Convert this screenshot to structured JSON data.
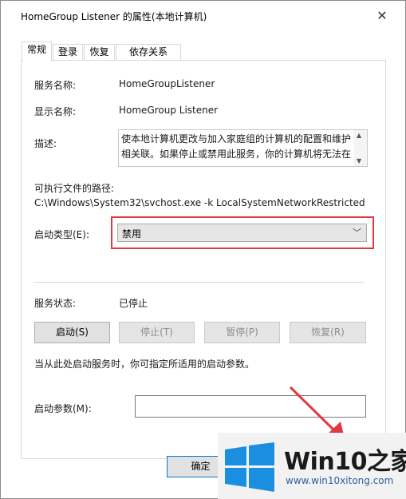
{
  "window": {
    "title": "HomeGroup Listener 的属性(本地计算机)",
    "close_glyph": "✕"
  },
  "tabs": [
    {
      "label": "常规",
      "active": true
    },
    {
      "label": "登录",
      "active": false
    },
    {
      "label": "恢复",
      "active": false
    },
    {
      "label": "依存关系",
      "active": false
    }
  ],
  "general": {
    "service_name_label": "服务名称:",
    "service_name": "HomeGroupListener",
    "display_name_label": "显示名称:",
    "display_name": "HomeGroup Listener",
    "description_label": "描述:",
    "description": "使本地计算机更改与加入家庭组的计算机的配置和维护相关联。如果停止或禁用此服务，你的计算机将无法在",
    "exe_path_label": "可执行文件的路径:",
    "exe_path": "C:\\Windows\\System32\\svchost.exe -k LocalSystemNetworkRestricted",
    "startup_type_label": "启动类型(E):",
    "startup_type_value": "禁用",
    "service_status_label": "服务状态:",
    "service_status": "已停止",
    "hint": "当从此处启动服务时，你可指定所适用的启动参数。",
    "start_params_label": "启动参数(M):",
    "start_params_value": ""
  },
  "buttons": {
    "start": "启动(S)",
    "stop": "停止(T)",
    "pause": "暂停(P)",
    "resume": "恢复(R)",
    "ok": "确定"
  },
  "icons": {
    "close": "close-icon",
    "chevron": "chevron-down-icon",
    "scroll_up": "scroll-up-icon",
    "scroll_down": "scroll-down-icon"
  },
  "colors": {
    "highlight": "#e0383e",
    "accent": "#0078d7",
    "logo_blue": "#1a8fe0"
  },
  "watermark": {
    "brand": "Win10之家",
    "url": "www.win10xitong.com"
  }
}
